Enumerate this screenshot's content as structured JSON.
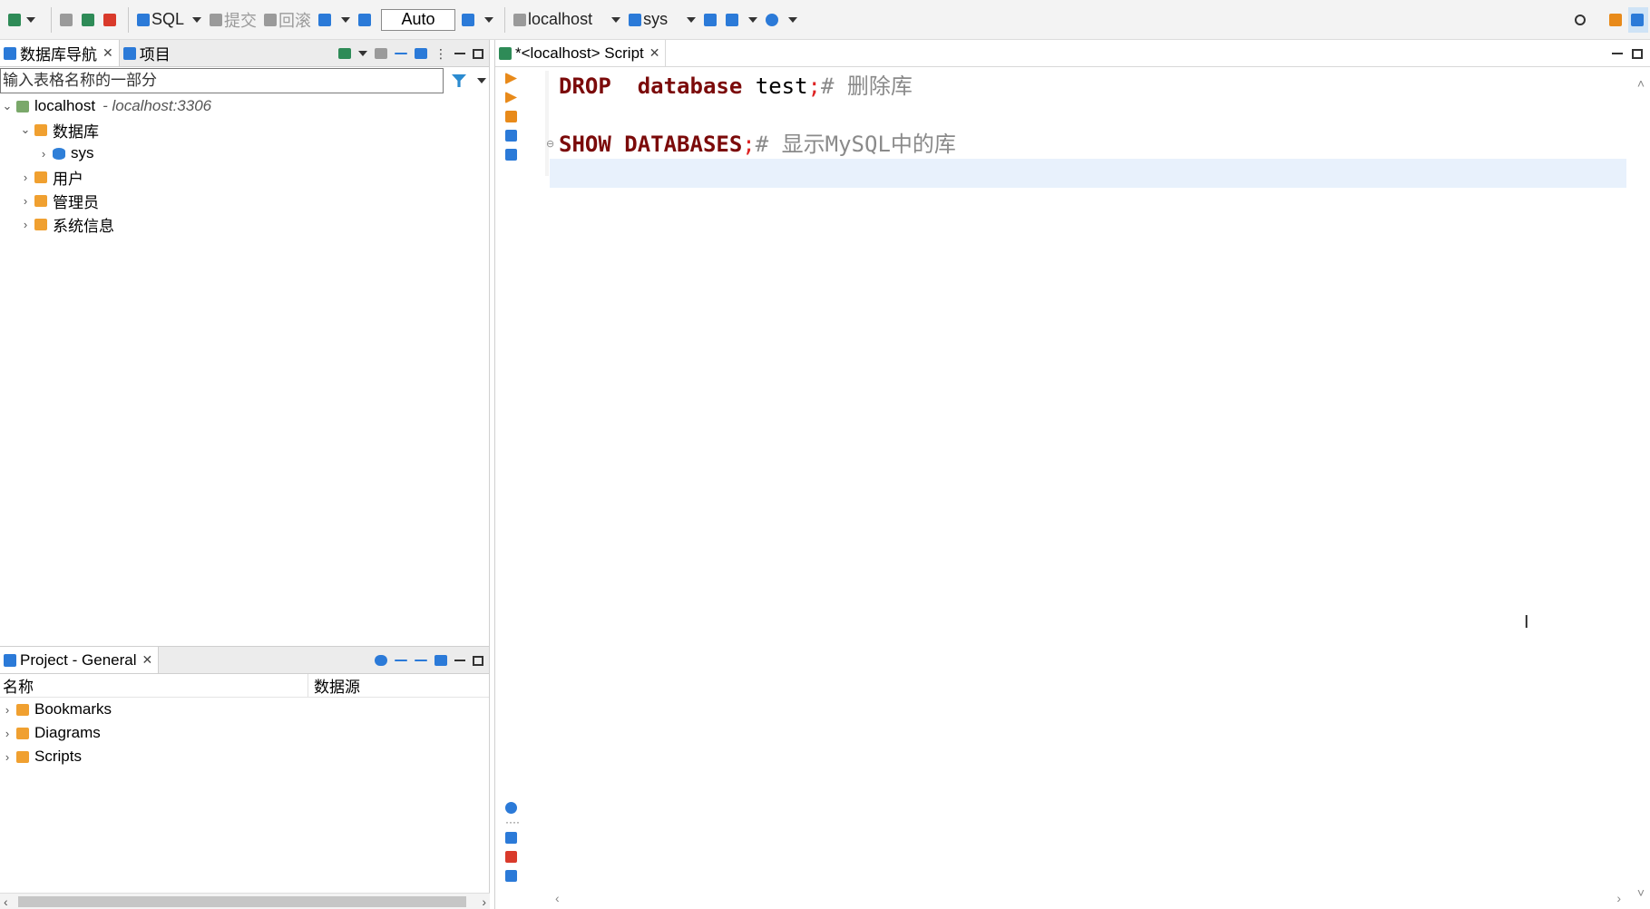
{
  "toolbar": {
    "sql_label": "SQL",
    "commit_label": "提交",
    "rollback_label": "回滚",
    "auto_label": "Auto",
    "connection_label": "localhost",
    "schema_label": "sys"
  },
  "left_nav": {
    "tab_db_nav": "数据库导航",
    "tab_projects": "项目",
    "filter_placeholder": "输入表格名称的一部分",
    "tree": {
      "host": "localhost",
      "host_detail": "- localhost:3306",
      "databases": "数据库",
      "sys": "sys",
      "users": "用户",
      "admins": "管理员",
      "sysinfo": "系统信息"
    }
  },
  "project_pane": {
    "tab_label": "Project - General",
    "col_name": "名称",
    "col_source": "数据源",
    "items": [
      "Bookmarks",
      "Diagrams",
      "Scripts"
    ]
  },
  "editor": {
    "tab_label": "*<localhost> Script",
    "line1": {
      "kw1": "DROP",
      "kw2": "database",
      "ident": "test",
      "semi": ";",
      "comment": "# 删除库"
    },
    "line2": {
      "kw1": "SHOW",
      "kw2": "DATABASES",
      "semi": ";",
      "comment": "# 显示MySQL中的库"
    }
  }
}
